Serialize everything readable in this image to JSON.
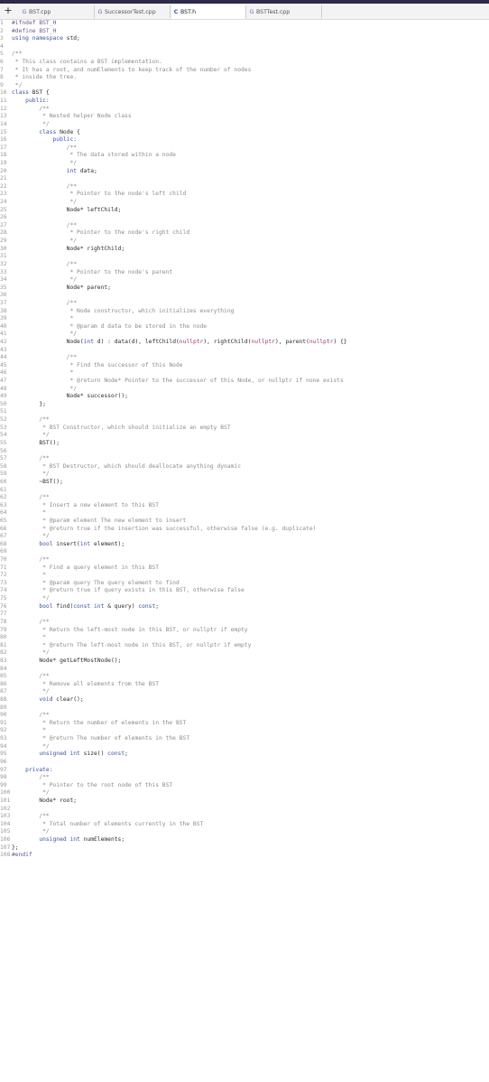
{
  "tabs": [
    {
      "label": "BST.cpp",
      "icon": "cpp-file-icon",
      "active": false
    },
    {
      "label": "SuccessorTest.cpp",
      "icon": "cpp-file-icon",
      "active": false
    },
    {
      "label": "BST.h",
      "icon": "header-file-icon",
      "active": true
    },
    {
      "label": "BSTTest.cpp",
      "icon": "cpp-file-icon",
      "active": false
    }
  ],
  "new_tab_label": "+",
  "colors": {
    "comment": "#8c8c8c",
    "preprocessor": "#6a5a8c",
    "keyword": "#3a53a4",
    "special": "#9b3a7a",
    "plain": "#2b2b2b",
    "line_number": "#9a9a9a",
    "accent_bar": "#2e2a4a"
  },
  "editor": {
    "lines": [
      [
        [
          "p",
          "#ifndef BST_H"
        ]
      ],
      [
        [
          "p",
          "#define BST_H"
        ]
      ],
      [
        [
          "k",
          "using namespace "
        ],
        [
          "t",
          "std;"
        ]
      ],
      [],
      [
        [
          "c",
          "/**"
        ]
      ],
      [
        [
          "c",
          " * This class contains a BST implementation."
        ]
      ],
      [
        [
          "c",
          " * It has a root, and numElements to keep track of the number of nodes"
        ]
      ],
      [
        [
          "c",
          " * inside the tree."
        ]
      ],
      [
        [
          "c",
          " */"
        ]
      ],
      [
        [
          "k",
          "class "
        ],
        [
          "t",
          "BST {"
        ]
      ],
      [
        [
          "k",
          "    public:"
        ]
      ],
      [
        [
          "c",
          "        /**"
        ]
      ],
      [
        [
          "c",
          "         * Nested helper Node class"
        ]
      ],
      [
        [
          "c",
          "         */"
        ]
      ],
      [
        [
          "k",
          "        class "
        ],
        [
          "t",
          "Node {"
        ]
      ],
      [
        [
          "k",
          "            public:"
        ]
      ],
      [
        [
          "c",
          "                /**"
        ]
      ],
      [
        [
          "c",
          "                 * The data stored within a node"
        ]
      ],
      [
        [
          "c",
          "                 */"
        ]
      ],
      [
        [
          "k",
          "                int "
        ],
        [
          "t",
          "data;"
        ]
      ],
      [],
      [
        [
          "c",
          "                /**"
        ]
      ],
      [
        [
          "c",
          "                 * Pointer to the node's left child"
        ]
      ],
      [
        [
          "c",
          "                 */"
        ]
      ],
      [
        [
          "t",
          "                Node* leftChild;"
        ]
      ],
      [],
      [
        [
          "c",
          "                /**"
        ]
      ],
      [
        [
          "c",
          "                 * Pointer to the node's right child"
        ]
      ],
      [
        [
          "c",
          "                 */"
        ]
      ],
      [
        [
          "t",
          "                Node* rightChild;"
        ]
      ],
      [],
      [
        [
          "c",
          "                /**"
        ]
      ],
      [
        [
          "c",
          "                 * Pointer to the node's parent"
        ]
      ],
      [
        [
          "c",
          "                 */"
        ]
      ],
      [
        [
          "t",
          "                Node* parent;"
        ]
      ],
      [],
      [
        [
          "c",
          "                /**"
        ]
      ],
      [
        [
          "c",
          "                 * Node constructor, which initializes everything"
        ]
      ],
      [
        [
          "c",
          "                 *"
        ]
      ],
      [
        [
          "c",
          "                 * @param d data to be stored in the node"
        ]
      ],
      [
        [
          "c",
          "                 */"
        ]
      ],
      [
        [
          "t",
          "                Node("
        ],
        [
          "k",
          "int "
        ],
        [
          "t",
          "d) : data(d), leftChild("
        ],
        [
          "s",
          "nullptr"
        ],
        [
          "t",
          "), rightChild("
        ],
        [
          "s",
          "nullptr"
        ],
        [
          "t",
          "), parent("
        ],
        [
          "s",
          "nullptr"
        ],
        [
          "t",
          ") {}"
        ]
      ],
      [],
      [
        [
          "c",
          "                /**"
        ]
      ],
      [
        [
          "c",
          "                 * Find the successor of this Node"
        ]
      ],
      [
        [
          "c",
          "                 *"
        ]
      ],
      [
        [
          "c",
          "                 * @return Node* Pointer to the successor of this Node, or nullptr if none exists"
        ]
      ],
      [
        [
          "c",
          "                 */"
        ]
      ],
      [
        [
          "t",
          "                Node* successor();"
        ]
      ],
      [
        [
          "t",
          "        };"
        ]
      ],
      [],
      [
        [
          "c",
          "        /**"
        ]
      ],
      [
        [
          "c",
          "         * BST Constructor, which should initialize an empty BST"
        ]
      ],
      [
        [
          "c",
          "         */"
        ]
      ],
      [
        [
          "t",
          "        BST();"
        ]
      ],
      [],
      [
        [
          "c",
          "        /**"
        ]
      ],
      [
        [
          "c",
          "         * BST Destructor, which should deallocate anything dynamic"
        ]
      ],
      [
        [
          "c",
          "         */"
        ]
      ],
      [
        [
          "t",
          "        ~BST();"
        ]
      ],
      [],
      [
        [
          "c",
          "        /**"
        ]
      ],
      [
        [
          "c",
          "         * Insert a new element to this BST"
        ]
      ],
      [
        [
          "c",
          "         *"
        ]
      ],
      [
        [
          "c",
          "         * @param element The new element to insert"
        ]
      ],
      [
        [
          "c",
          "         * @return true if the insertion was successful, otherwise false (e.g. duplicate)"
        ]
      ],
      [
        [
          "c",
          "         */"
        ]
      ],
      [
        [
          "k",
          "        bool "
        ],
        [
          "t",
          "insert("
        ],
        [
          "k",
          "int "
        ],
        [
          "t",
          "element);"
        ]
      ],
      [],
      [
        [
          "c",
          "        /**"
        ]
      ],
      [
        [
          "c",
          "         * Find a query element in this BST"
        ]
      ],
      [
        [
          "c",
          "         *"
        ]
      ],
      [
        [
          "c",
          "         * @param query The query element to find"
        ]
      ],
      [
        [
          "c",
          "         * @return true if query exists in this BST, otherwise false"
        ]
      ],
      [
        [
          "c",
          "         */"
        ]
      ],
      [
        [
          "k",
          "        bool "
        ],
        [
          "t",
          "find("
        ],
        [
          "k",
          "const int "
        ],
        [
          "t",
          "& query) "
        ],
        [
          "k",
          "const"
        ],
        [
          "t",
          ";"
        ]
      ],
      [],
      [
        [
          "c",
          "        /**"
        ]
      ],
      [
        [
          "c",
          "         * Return the left-most node in this BST, or nullptr if empty"
        ]
      ],
      [
        [
          "c",
          "         *"
        ]
      ],
      [
        [
          "c",
          "         * @return The left-most node in this BST, or nullptr if empty"
        ]
      ],
      [
        [
          "c",
          "         */"
        ]
      ],
      [
        [
          "t",
          "        Node* getLeftMostNode();"
        ]
      ],
      [],
      [
        [
          "c",
          "        /**"
        ]
      ],
      [
        [
          "c",
          "         * Remove all elements from the BST"
        ]
      ],
      [
        [
          "c",
          "         */"
        ]
      ],
      [
        [
          "k",
          "        void "
        ],
        [
          "t",
          "clear();"
        ]
      ],
      [],
      [
        [
          "c",
          "        /**"
        ]
      ],
      [
        [
          "c",
          "         * Return the number of elements in the BST"
        ]
      ],
      [
        [
          "c",
          "         *"
        ]
      ],
      [
        [
          "c",
          "         * @return The number of elements in the BST"
        ]
      ],
      [
        [
          "c",
          "         */"
        ]
      ],
      [
        [
          "k",
          "        unsigned int "
        ],
        [
          "t",
          "size() "
        ],
        [
          "k",
          "const"
        ],
        [
          "t",
          ";"
        ]
      ],
      [],
      [
        [
          "k",
          "    private:"
        ]
      ],
      [
        [
          "c",
          "        /**"
        ]
      ],
      [
        [
          "c",
          "         * Pointer to the root node of this BST"
        ]
      ],
      [
        [
          "c",
          "         */"
        ]
      ],
      [
        [
          "t",
          "        Node* root;"
        ]
      ],
      [],
      [
        [
          "c",
          "        /**"
        ]
      ],
      [
        [
          "c",
          "         * Total number of elements currently in the BST"
        ]
      ],
      [
        [
          "c",
          "         */"
        ]
      ],
      [
        [
          "k",
          "        unsigned int "
        ],
        [
          "t",
          "numElements;"
        ]
      ],
      [
        [
          "t",
          "};"
        ]
      ],
      [
        [
          "p",
          "#endif"
        ]
      ]
    ]
  }
}
